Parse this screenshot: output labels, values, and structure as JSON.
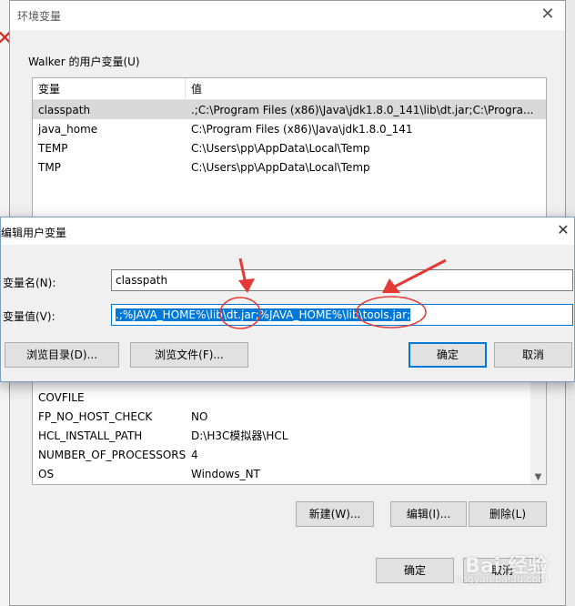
{
  "env_window": {
    "title": "环境变量",
    "user_group_label": "Walker 的用户变量(U)",
    "user_columns": [
      "变量",
      "值"
    ],
    "user_rows": [
      {
        "name": "classpath",
        "value": ".;C:\\Program Files (x86)\\Java\\jdk1.8.0_141\\lib\\dt.jar;C:\\Progra..."
      },
      {
        "name": "java_home",
        "value": "C:\\Program Files (x86)\\Java\\jdk1.8.0_141"
      },
      {
        "name": "TEMP",
        "value": "C:\\Users\\pp\\AppData\\Local\\Temp"
      },
      {
        "name": "TMP",
        "value": "C:\\Users\\pp\\AppData\\Local\\Temp"
      }
    ],
    "system_rows": [
      {
        "name": "COVFILE",
        "value": ""
      },
      {
        "name": "FP_NO_HOST_CHECK",
        "value": "NO"
      },
      {
        "name": "HCL_INSTALL_PATH",
        "value": "D:\\H3C模拟器\\HCL"
      },
      {
        "name": "NUMBER_OF_PROCESSORS",
        "value": "4"
      },
      {
        "name": "OS",
        "value": "Windows_NT"
      }
    ],
    "buttons": {
      "new": "新建(W)...",
      "edit": "编辑(I)...",
      "delete": "删除(L)",
      "ok": "确定",
      "cancel": "取消"
    }
  },
  "edit_dialog": {
    "title": "编辑用户变量",
    "name_label": "变量名(N):",
    "name_value": "classpath",
    "value_label": "变量值(V):",
    "value_value": ".;%JAVA_HOME%\\lib\\dt.jar;%JAVA_HOME%\\lib\\tools.jar;",
    "buttons": {
      "browse_dir": "浏览目录(D)...",
      "browse_file": "浏览文件(F)...",
      "ok": "确定",
      "cancel": "取消"
    }
  },
  "watermark": {
    "brand": "Bai 经验",
    "url": "jingyan.baidu.com"
  },
  "colors": {
    "selection": "#0078d7",
    "annotation": "#e53935"
  }
}
